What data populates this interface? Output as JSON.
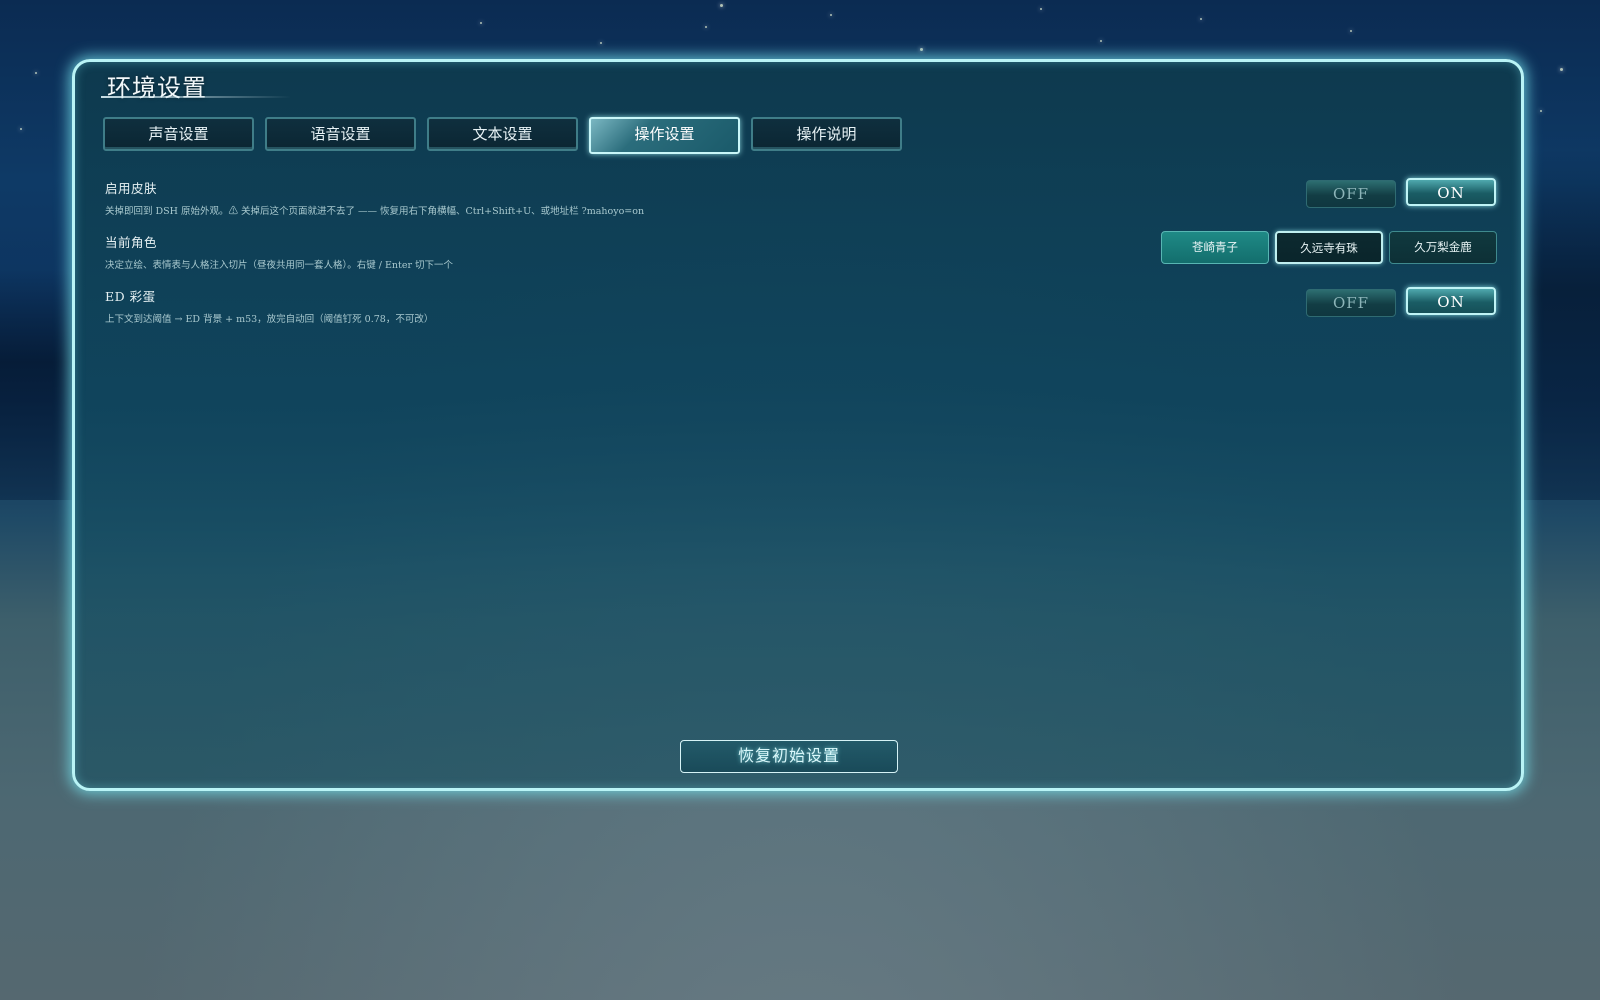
{
  "panel": {
    "title": "环境设置"
  },
  "tabs": [
    {
      "label": "声音设置",
      "active": false
    },
    {
      "label": "语音设置",
      "active": false
    },
    {
      "label": "文本设置",
      "active": false
    },
    {
      "label": "操作设置",
      "active": true
    },
    {
      "label": "操作说明",
      "active": false
    }
  ],
  "settings": {
    "skin": {
      "title": "启用皮肤",
      "desc": "关掉即回到 DSH 原始外观。⚠ 关掉后这个页面就进不去了 —— 恢复用右下角横幅、Ctrl+Shift+U、或地址栏 ?mahoyo=on",
      "off_label": "OFF",
      "on_label": "ON",
      "value": "ON"
    },
    "character": {
      "title": "当前角色",
      "desc": "决定立绘、表情表与人格注入切片（昼夜共用同一套人格）。右键 / Enter 切下一个",
      "options": [
        "苍崎青子",
        "久远寺有珠",
        "久万梨金鹿"
      ],
      "selected": "苍崎青子"
    },
    "ed_easter": {
      "title": "ED 彩蛋",
      "desc": "上下文到达阈值 → ED 背景 + m53，放完自动回（阈值钉死 0.78，不可改）",
      "off_label": "OFF",
      "on_label": "ON",
      "value": "ON"
    }
  },
  "reset_label": "恢复初始设置",
  "colors": {
    "accent": "#b9f4f6",
    "panel_bg": "#104656",
    "selected_char": "#1f8a86"
  }
}
